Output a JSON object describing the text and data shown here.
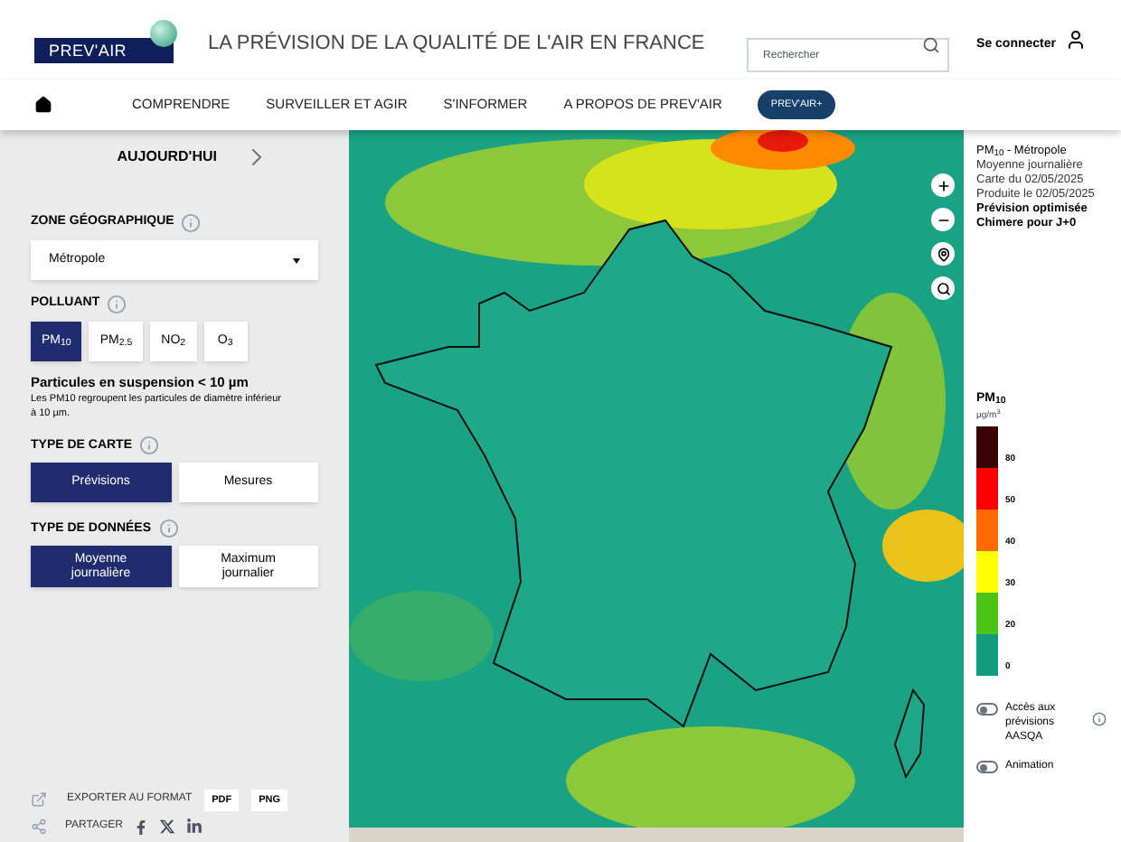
{
  "header": {
    "logo": "PREV'AIR",
    "title": "LA PRÉVISION DE LA QUALITÉ DE L'AIR EN FRANCE",
    "search": {
      "placeholder": "Rechercher"
    },
    "login": "Se connecter"
  },
  "nav": {
    "items": [
      "COMPRENDRE",
      "SURVEILLER ET AGIR",
      "S'INFORMER",
      "A PROPOS DE PREV'AIR"
    ],
    "badge": "PREV'AIR+"
  },
  "sidebar": {
    "day": "AUJOURD'HUI",
    "zone": {
      "label": "ZONE GÉOGRAPHIQUE",
      "value": "Métropole"
    },
    "pollutant": {
      "label": "POLLUANT",
      "options": [
        {
          "label": "PM$_{10}$",
          "selected": true
        },
        {
          "label": "PM$_{2.5}$",
          "selected": false
        },
        {
          "label": "NO$_{2}$",
          "selected": false
        },
        {
          "label": "O$_{3}$",
          "selected": false
        }
      ],
      "title": "Particules en suspension < 10 µm",
      "description": "Les PM10 regroupent les particules de diamètre inférieur à 10 µm."
    },
    "map_type": {
      "label": "TYPE DE CARTE",
      "options": [
        {
          "label": "Prévisions",
          "selected": true
        },
        {
          "label": "Mesures",
          "selected": false
        }
      ]
    },
    "data_type": {
      "label": "TYPE DE DONNÉES",
      "options": [
        {
          "label": "Moyenne journalière",
          "selected": true
        },
        {
          "label": "Maximum journalier",
          "selected": false
        }
      ]
    },
    "export": {
      "label": "EXPORTER AU FORMAT",
      "formats": [
        "PDF",
        "PNG"
      ]
    },
    "share": {
      "label": "PARTAGER"
    }
  },
  "info": {
    "title": "PM$_{10}$ - Métropole",
    "lines": [
      "Moyenne journalière",
      "Carte du 02/05/2025",
      "Produite le 02/05/2025"
    ],
    "note": "Prévision optimisée Chimere pour J+0"
  },
  "legend": {
    "title": "PM$_{10}$",
    "unit": "µg/m$^{3}$",
    "steps": [
      {
        "label": "80",
        "color": "#3a0303"
      },
      {
        "label": "50",
        "color": "#ff0000"
      },
      {
        "label": "40",
        "color": "#ff6a00"
      },
      {
        "label": "30",
        "color": "#ffff00"
      },
      {
        "label": "20",
        "color": "#4cc614"
      },
      {
        "label": "0",
        "color": "#139c7c"
      }
    ]
  },
  "toggles": [
    {
      "label": "Accès aux prévisions AASQA",
      "on": false
    },
    {
      "label": "Animation",
      "on": false
    }
  ]
}
